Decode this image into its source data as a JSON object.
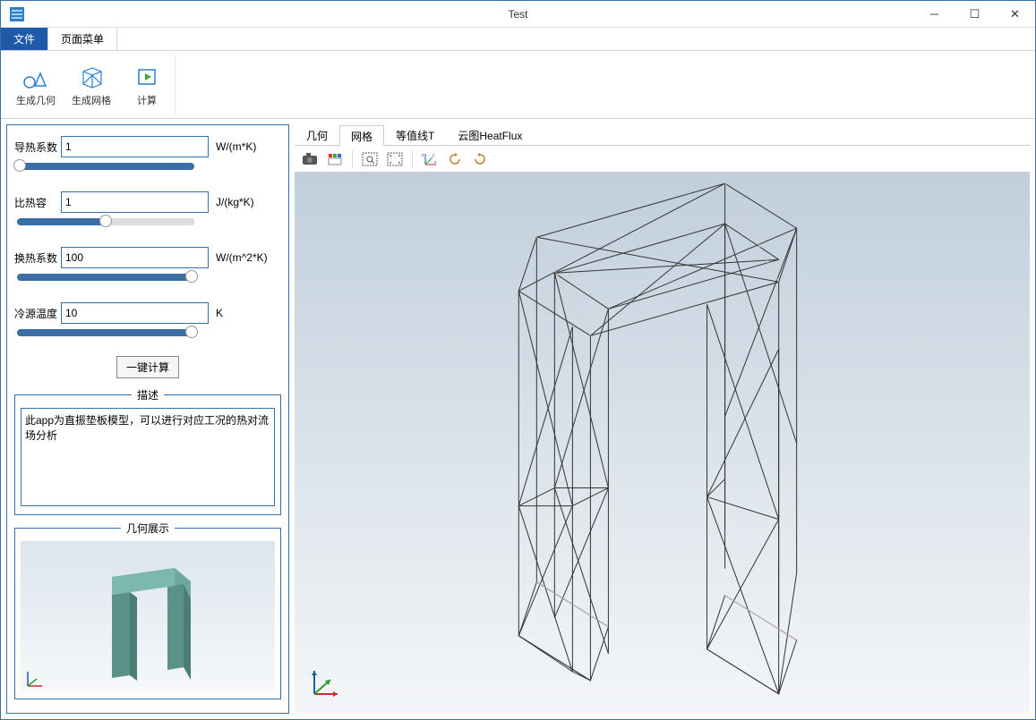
{
  "window": {
    "title": "Test"
  },
  "menu": {
    "file": "文件",
    "page": "页面菜单"
  },
  "ribbon": {
    "geom": "生成几何",
    "mesh": "生成网格",
    "compute": "计算"
  },
  "params": {
    "k": {
      "label": "导热系数",
      "value": "1",
      "unit": "W/(m*K)"
    },
    "cp": {
      "label": "比热容",
      "value": "1",
      "unit": "J/(kg*K)"
    },
    "h": {
      "label": "换热系数",
      "value": "100",
      "unit": "W/(m^2*K)"
    },
    "tc": {
      "label": "冷源温度",
      "value": "10",
      "unit": "K"
    }
  },
  "buttons": {
    "oneclick": "一键计算"
  },
  "panels": {
    "desc_title": "描述",
    "desc_text": "此app为直振垫板模型，可以进行对应工况的热对流场分析",
    "preview_title": "几何展示"
  },
  "viewtabs": {
    "geom": "几何",
    "mesh": "网格",
    "isoT": "等值线T",
    "cloud": "云图HeatFlux"
  },
  "icons": {
    "camera": "camera",
    "layers": "layers",
    "zoomwin": "zoom-window",
    "fit": "fit-all",
    "axes": "axes-xyz",
    "rot_ccw": "rotate-ccw",
    "rot_cw": "rotate-cw"
  }
}
